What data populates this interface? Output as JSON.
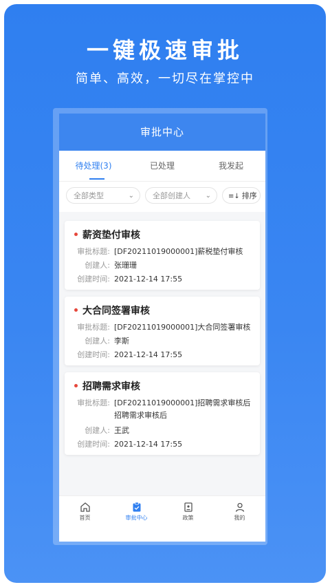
{
  "promo": {
    "headline": "一键极速审批",
    "subline": "简单、高效，一切尽在掌控中"
  },
  "header": {
    "title": "审批中心"
  },
  "tabs": [
    {
      "label": "待处理(3)",
      "active": true
    },
    {
      "label": "已处理",
      "active": false
    },
    {
      "label": "我发起",
      "active": false
    }
  ],
  "filters": {
    "type_label": "全部类型",
    "creator_label": "全部创建人",
    "sort_label": "排序"
  },
  "field_labels": {
    "subject": "审批标题:",
    "creator": "创建人:",
    "created_at": "创建时间:"
  },
  "cards": [
    {
      "title": "薪资垫付审核",
      "subject": "[DF20211019000001]薪税垫付审核",
      "creator": "张珊珊",
      "created_at": "2021-12-14 17:55"
    },
    {
      "title": "大合同签署审核",
      "subject": "[DF20211019000001]大合同签署审核",
      "creator": "李斯",
      "created_at": "2021-12-14 17:55"
    },
    {
      "title": "招聘需求审核",
      "subject": "[DF20211019000001]招聘需求审核后招聘需求审核后",
      "creator": "王武",
      "created_at": "2021-12-14 17:55"
    }
  ],
  "bottom_nav": [
    {
      "label": "首页",
      "icon": "home-icon",
      "active": false
    },
    {
      "label": "审批中心",
      "icon": "approval-icon",
      "active": true
    },
    {
      "label": "政策",
      "icon": "policy-icon",
      "active": false
    },
    {
      "label": "我的",
      "icon": "profile-icon",
      "active": false
    }
  ],
  "colors": {
    "brand": "#2f7ff0",
    "header": "#3d86ef",
    "dot": "#e6473b"
  }
}
